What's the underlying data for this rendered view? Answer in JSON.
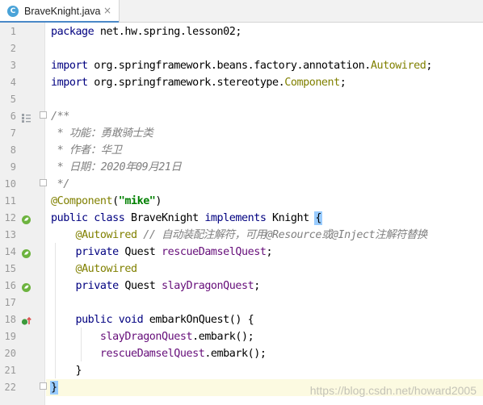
{
  "tab": {
    "icon_letter": "C",
    "label": "BraveKnight.java",
    "close_glyph": "×"
  },
  "lines": [
    {
      "n": "1",
      "parts": [
        [
          "kw",
          "package "
        ],
        [
          "",
          "net.hw.spring.lesson02;"
        ]
      ]
    },
    {
      "n": "2",
      "parts": []
    },
    {
      "n": "3",
      "parts": [
        [
          "kw",
          "import "
        ],
        [
          "",
          "org.springframework.beans.factory.annotation."
        ],
        [
          "cls",
          "Autowired"
        ],
        [
          "",
          ";"
        ]
      ]
    },
    {
      "n": "4",
      "parts": [
        [
          "kw",
          "import "
        ],
        [
          "",
          "org.springframework.stereotype."
        ],
        [
          "cls",
          "Component"
        ],
        [
          "",
          ";"
        ]
      ]
    },
    {
      "n": "5",
      "parts": []
    },
    {
      "n": "6",
      "parts": [
        [
          "cmt",
          "/**"
        ]
      ],
      "marker": "doc"
    },
    {
      "n": "7",
      "parts": [
        [
          "cmt",
          " * 功能：勇敢骑士类"
        ]
      ]
    },
    {
      "n": "8",
      "parts": [
        [
          "cmt",
          " * 作者：华卫"
        ]
      ]
    },
    {
      "n": "9",
      "parts": [
        [
          "cmt",
          " * 日期：2020年09月21日"
        ]
      ]
    },
    {
      "n": "10",
      "parts": [
        [
          "cmt",
          " */"
        ]
      ]
    },
    {
      "n": "11",
      "parts": [
        [
          "ann",
          "@Component"
        ],
        [
          "",
          "("
        ],
        [
          "str",
          "\"mike\""
        ],
        [
          "",
          ")"
        ]
      ]
    },
    {
      "n": "12",
      "parts": [
        [
          "kw",
          "public class "
        ],
        [
          "",
          "BraveKnight "
        ],
        [
          "kw",
          "implements "
        ],
        [
          "",
          "Knight "
        ],
        [
          "brace-hl",
          "{"
        ]
      ],
      "marker": "bean"
    },
    {
      "n": "13",
      "parts": [
        [
          "",
          "    "
        ],
        [
          "ann",
          "@Autowired"
        ],
        [
          "",
          " "
        ],
        [
          "cmt",
          "// 自动装配注解符，可用@Resource或@Inject注解符替换"
        ]
      ]
    },
    {
      "n": "14",
      "parts": [
        [
          "",
          "    "
        ],
        [
          "kw",
          "private "
        ],
        [
          "",
          "Quest "
        ],
        [
          "fld",
          "rescueDamselQuest"
        ],
        [
          "",
          ";"
        ]
      ],
      "marker": "bean"
    },
    {
      "n": "15",
      "parts": [
        [
          "",
          "    "
        ],
        [
          "ann",
          "@Autowired"
        ]
      ]
    },
    {
      "n": "16",
      "parts": [
        [
          "",
          "    "
        ],
        [
          "kw",
          "private "
        ],
        [
          "",
          "Quest "
        ],
        [
          "fld",
          "slayDragonQuest"
        ],
        [
          "",
          ";"
        ]
      ],
      "marker": "bean"
    },
    {
      "n": "17",
      "parts": []
    },
    {
      "n": "18",
      "parts": [
        [
          "",
          "    "
        ],
        [
          "kw",
          "public void "
        ],
        [
          "",
          "embarkOnQuest() {"
        ]
      ],
      "marker": "override"
    },
    {
      "n": "19",
      "parts": [
        [
          "",
          "        "
        ],
        [
          "fld",
          "slayDragonQuest"
        ],
        [
          "",
          ".embark();"
        ]
      ]
    },
    {
      "n": "20",
      "parts": [
        [
          "",
          "        "
        ],
        [
          "fld",
          "rescueDamselQuest"
        ],
        [
          "",
          ".embark();"
        ]
      ]
    },
    {
      "n": "21",
      "parts": [
        [
          "",
          "    }"
        ]
      ]
    },
    {
      "n": "22",
      "parts": [
        [
          "brace-hl",
          "}"
        ]
      ],
      "current": true
    }
  ],
  "watermark": "https://blog.csdn.net/howard2005",
  "colors": {
    "keyword": "#000080",
    "annotation": "#808000",
    "string": "#008000",
    "field": "#660e7a",
    "comment": "#808080",
    "current_line": "#fcfae1",
    "brace_match": "#99ccff"
  },
  "icons": {
    "tab": "java-class-icon",
    "doc": "javadoc-icon",
    "bean": "spring-bean-icon",
    "override": "implements-method-icon"
  }
}
